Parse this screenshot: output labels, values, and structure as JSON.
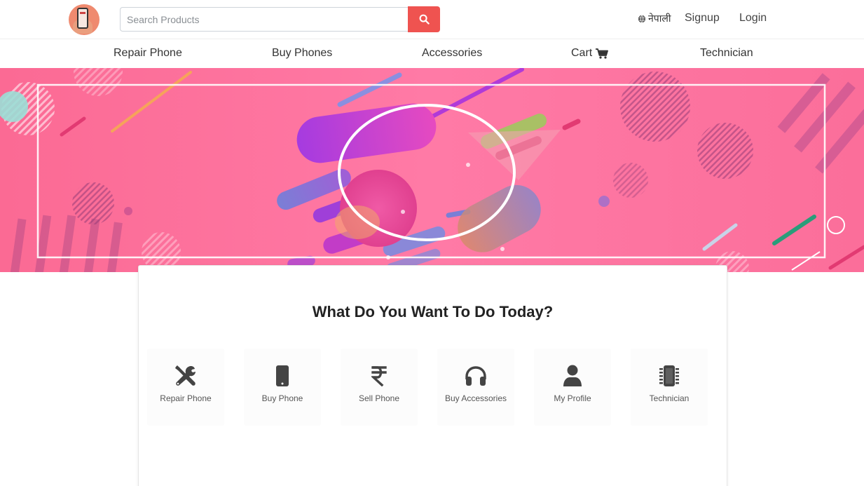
{
  "header": {
    "search_placeholder": "Search Products",
    "language_label": "नेपाली",
    "signup_label": "Signup",
    "login_label": "Login"
  },
  "nav": {
    "items": [
      {
        "label": "Repair Phone"
      },
      {
        "label": "Buy Phones"
      },
      {
        "label": "Accessories"
      },
      {
        "label": "Cart",
        "icon": "cart-icon"
      },
      {
        "label": "Technician"
      }
    ]
  },
  "main": {
    "title": "What Do You Want To Do Today?",
    "tiles": [
      {
        "label": "Repair Phone",
        "icon": "tools-icon"
      },
      {
        "label": "Buy Phone",
        "icon": "mobile-icon"
      },
      {
        "label": "Sell Phone",
        "icon": "rupee-icon"
      },
      {
        "label": "Buy Accessories",
        "icon": "headphones-icon"
      },
      {
        "label": "My Profile",
        "icon": "user-icon"
      },
      {
        "label": "Technician",
        "icon": "microchip-icon"
      }
    ]
  },
  "colors": {
    "accent": "#ef5350",
    "banner_pink": "#fe6f9a",
    "icon_gray": "#444444"
  }
}
